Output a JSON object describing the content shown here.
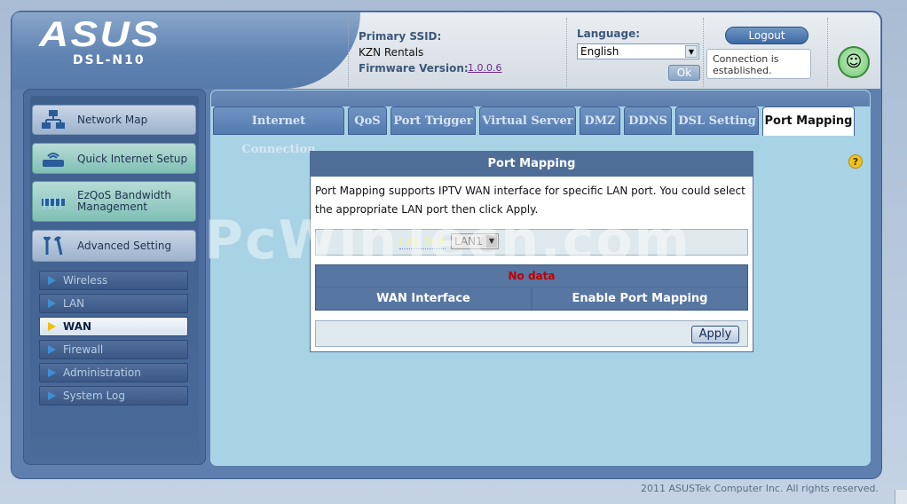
{
  "brand": {
    "logo": "ASUS",
    "model": "DSL-N10"
  },
  "header": {
    "ssid_label": "Primary SSID:",
    "ssid_value": "KZN Rentals",
    "firmware_label": "Firmware Version:",
    "firmware_value": "1.0.0.6",
    "language_label": "Language:",
    "language_value": "English",
    "ok_label": "Ok",
    "logout_label": "Logout",
    "connection_status": "Connection is established."
  },
  "sidebar": {
    "main_items": [
      {
        "label": "Network Map",
        "icon": "network-map-icon"
      },
      {
        "label": "Quick Internet Setup",
        "icon": "router-icon"
      },
      {
        "label": "EzQoS Bandwidth Management",
        "icon": "bandwidth-icon"
      },
      {
        "label": "Advanced Setting",
        "icon": "tools-icon"
      }
    ],
    "sub_items": [
      {
        "label": "Wireless"
      },
      {
        "label": "LAN"
      },
      {
        "label": "WAN"
      },
      {
        "label": "Firewall"
      },
      {
        "label": "Administration"
      },
      {
        "label": "System Log"
      }
    ],
    "active_sub": "WAN"
  },
  "tabs": [
    {
      "label": "Internet Connection"
    },
    {
      "label": "QoS"
    },
    {
      "label": "Port Trigger"
    },
    {
      "label": "Virtual Server"
    },
    {
      "label": "DMZ"
    },
    {
      "label": "DDNS"
    },
    {
      "label": "DSL Setting"
    },
    {
      "label": "Port Mapping"
    }
  ],
  "active_tab": "Port Mapping",
  "panel": {
    "title": "Port Mapping",
    "description": "Port Mapping supports IPTV WAN interface for specific LAN port. You could select the appropriate LAN port then click Apply.",
    "lan_port_label": "LAN Port",
    "lan_port_value": "LAN1",
    "no_data": "No data",
    "columns": [
      "WAN Interface",
      "Enable Port Mapping"
    ],
    "apply_label": "Apply"
  },
  "watermark": "PcWinTech.com",
  "footer": "2011 ASUSTek Computer Inc. All rights reserved.",
  "colors": {
    "accent": "#4e6e98",
    "content_bg": "#a8d3e4",
    "no_data": "#c00000"
  }
}
